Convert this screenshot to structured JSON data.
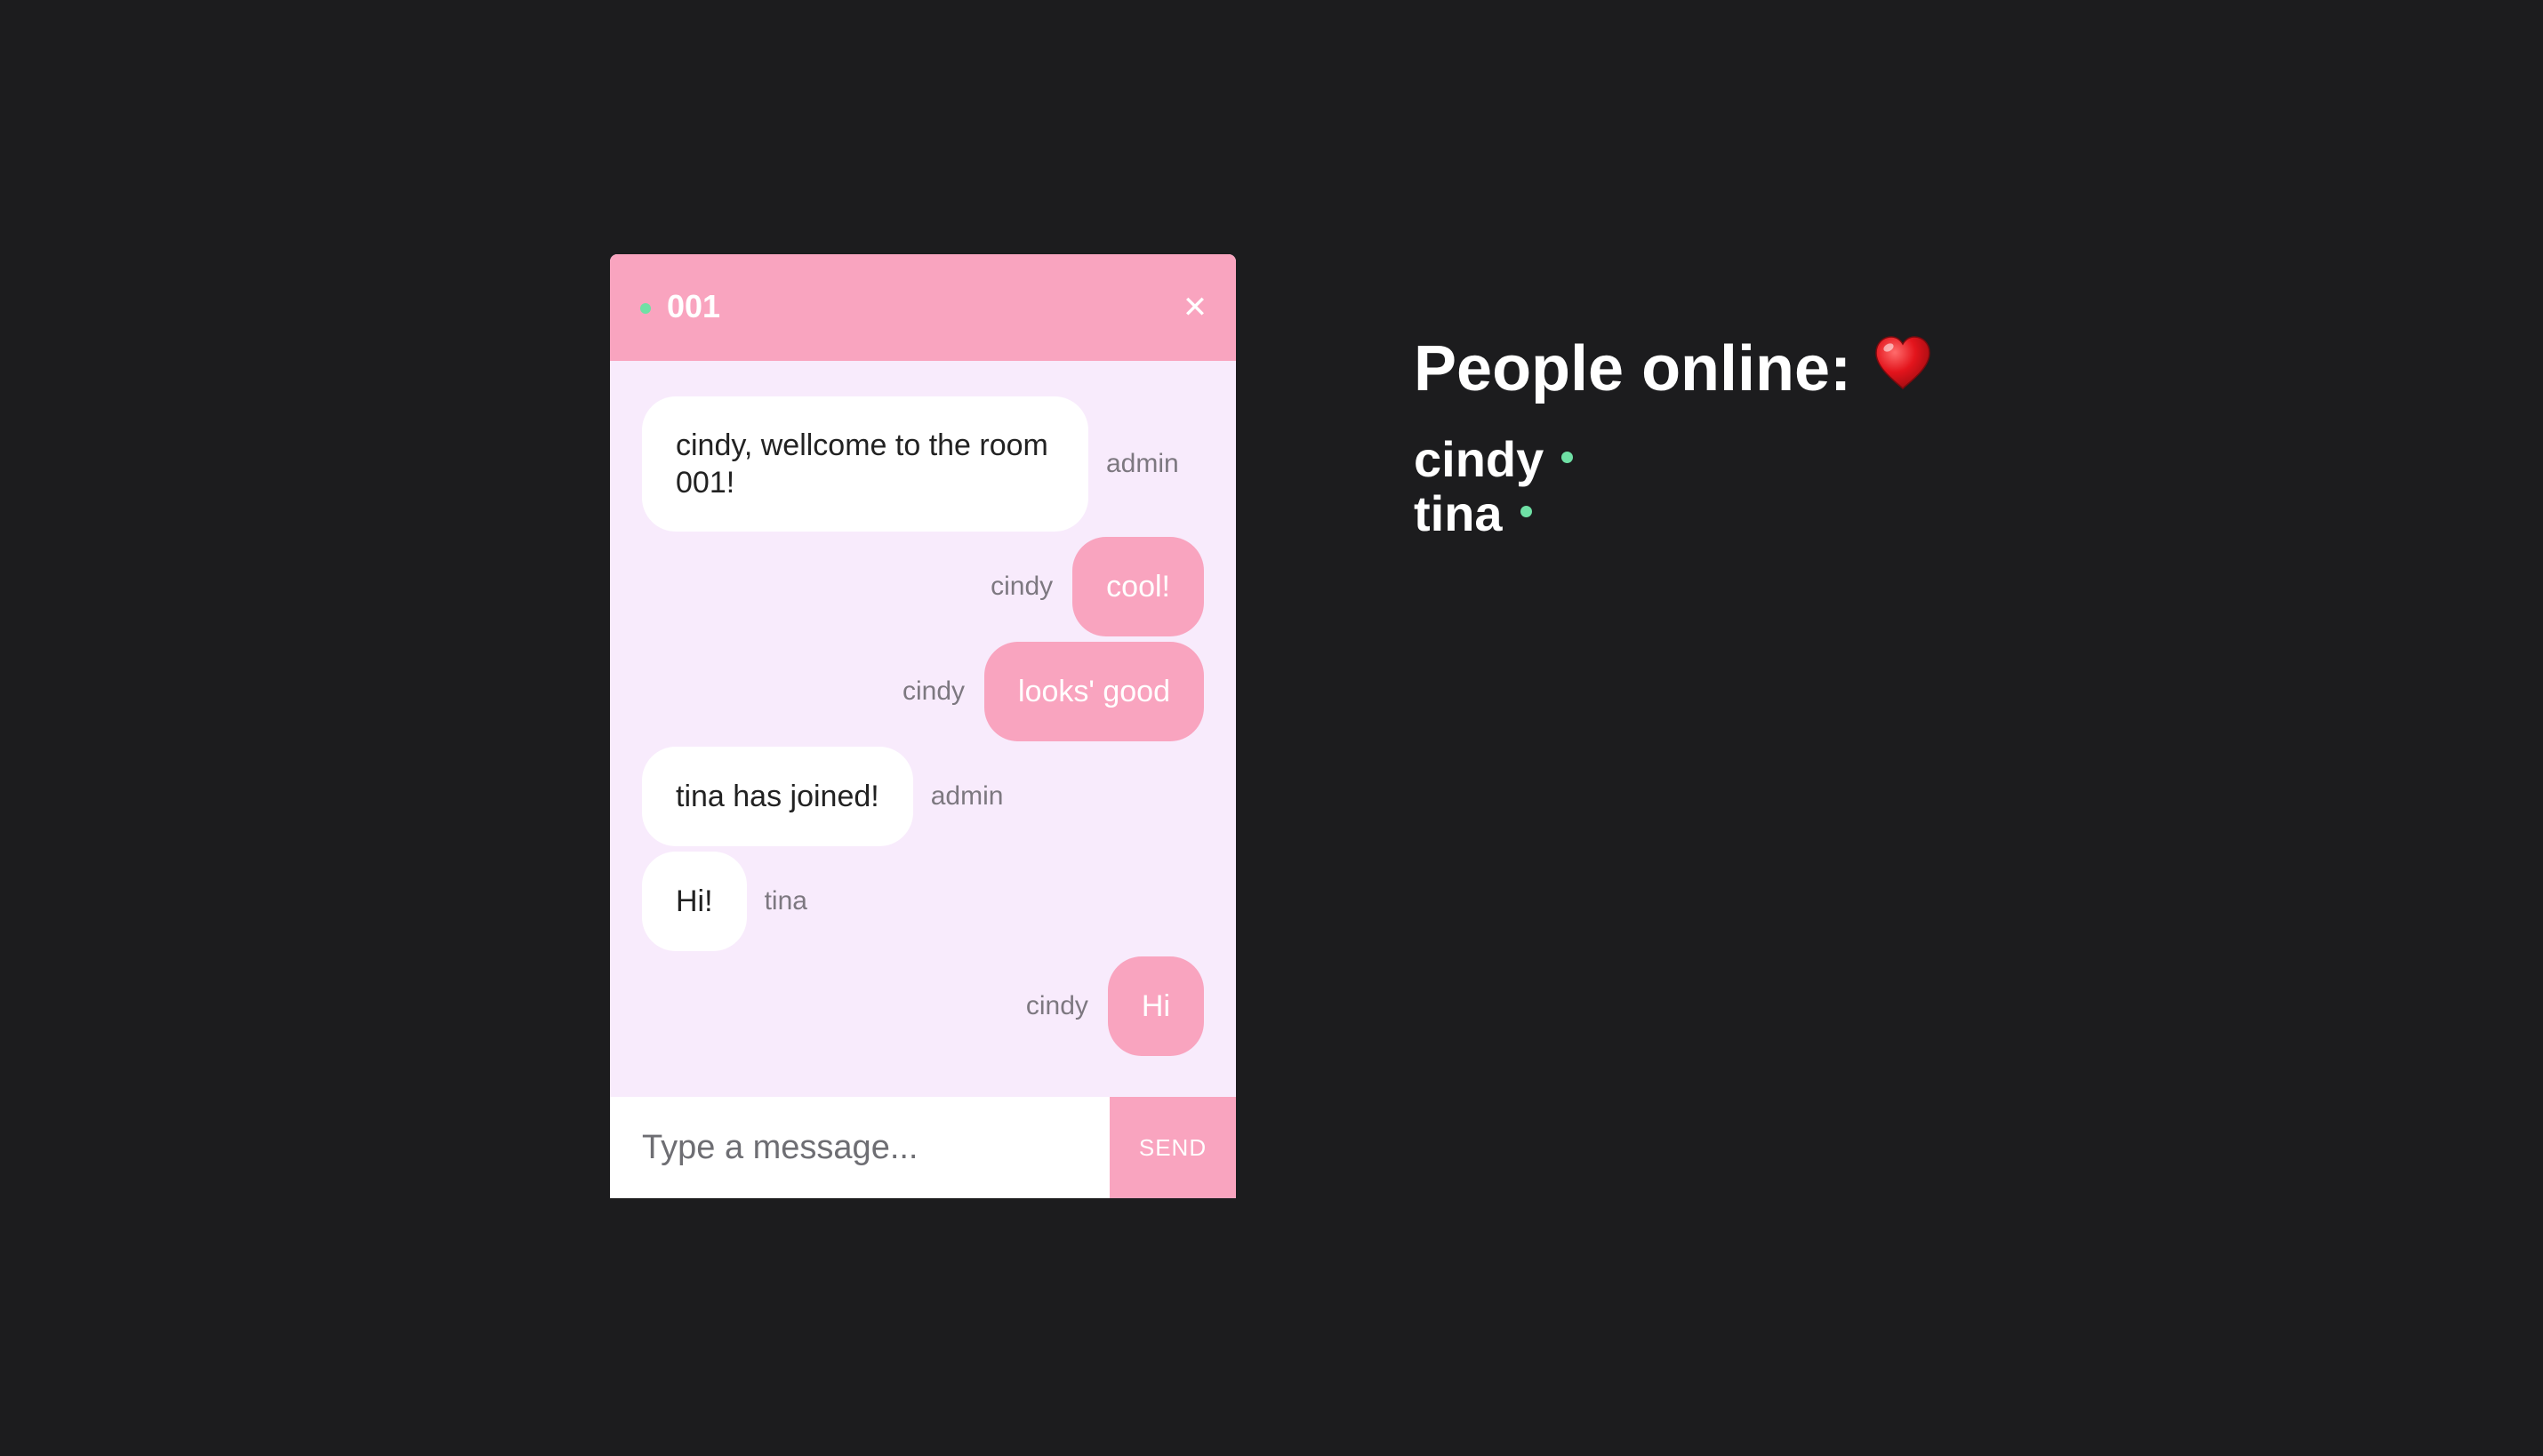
{
  "chat": {
    "room_title": "001",
    "close_icon": "close-icon",
    "close_glyph": "✕",
    "status_color": "#6fe0a5",
    "header_color": "#f9a4bf",
    "background_color": "#f8ebfc",
    "messages": [
      {
        "text": "cindy, wellcome to the room 001!",
        "sender": "admin",
        "side": "left"
      },
      {
        "text": "cool!",
        "sender": "cindy",
        "side": "right"
      },
      {
        "text": "looks' good",
        "sender": "cindy",
        "side": "right"
      },
      {
        "text": "tina has joined!",
        "sender": "admin",
        "side": "left"
      },
      {
        "text": "Hi!",
        "sender": "tina",
        "side": "left"
      },
      {
        "text": "Hi",
        "sender": "cindy",
        "side": "right"
      }
    ],
    "input": {
      "placeholder": "Type a message...",
      "value": ""
    },
    "send_label": "SEND"
  },
  "people": {
    "title": "People online:",
    "title_icon": "heart-icon",
    "users": [
      {
        "name": "cindy",
        "status": "online"
      },
      {
        "name": "tina",
        "status": "online"
      }
    ]
  }
}
